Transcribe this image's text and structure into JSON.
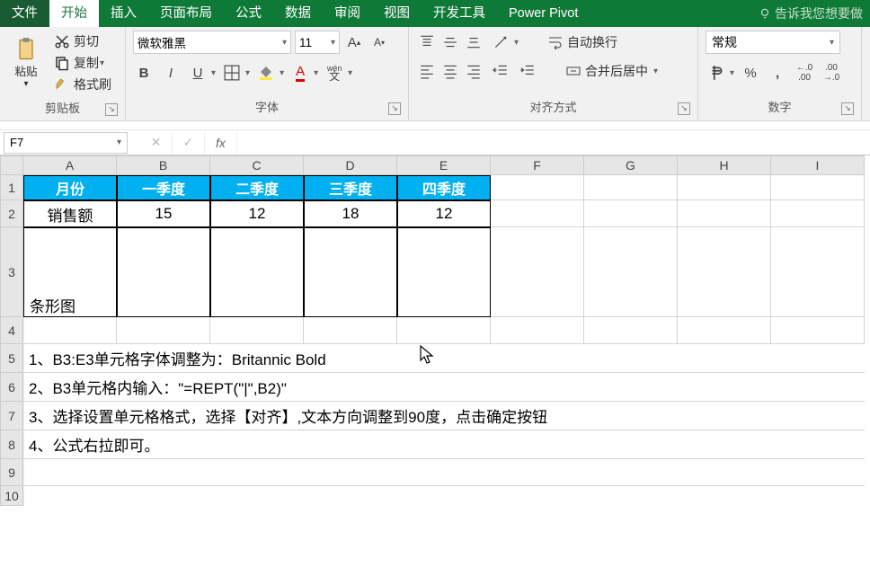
{
  "tabs": {
    "file": "文件",
    "home": "开始",
    "insert": "插入",
    "layout": "页面布局",
    "formula": "公式",
    "data": "数据",
    "review": "审阅",
    "view": "视图",
    "dev": "开发工具",
    "pivot": "Power Pivot",
    "tell": "告诉我您想要做"
  },
  "ribbon": {
    "paste": "粘贴",
    "cut": "剪切",
    "copy": "复制",
    "fmt": "格式刷",
    "clipboard_group": "剪贴板",
    "font_name": "微软雅黑",
    "font_size": "11",
    "wen": "wén",
    "wen2": "文",
    "font_group": "字体",
    "wrap": "自动换行",
    "merge": "合并后居中",
    "align_group": "对齐方式",
    "num_format": "常规",
    "num_group": "数字"
  },
  "fbar": {
    "name": "F7",
    "fx": "fx"
  },
  "chart_data": {
    "type": "table",
    "columns": [
      "月份",
      "一季度",
      "二季度",
      "三季度",
      "四季度"
    ],
    "rows": [
      {
        "label": "销售额",
        "values": [
          15,
          12,
          18,
          12
        ]
      },
      {
        "label": "条形图",
        "values": [
          "",
          "",
          "",
          ""
        ]
      }
    ]
  },
  "grid": {
    "cols": [
      "A",
      "B",
      "C",
      "D",
      "E",
      "F",
      "G",
      "H",
      "I"
    ],
    "h": {
      "a1": "月份",
      "b1": "一季度",
      "c1": "二季度",
      "d1": "三季度",
      "e1": "四季度"
    },
    "d": {
      "a2": "销售额",
      "b2": "15",
      "c2": "12",
      "d2": "18",
      "e2": "12",
      "a3": "条形图"
    },
    "notes": {
      "r5": "1、B3:E3单元格字体调整为：Britannic Bold",
      "r6": "2、B3单元格内输入：\"=REPT(\"|\",B2)\"",
      "r7": "3、选择设置单元格格式，选择【对齐】,文本方向调整到90度，点击确定按钮",
      "r8": "4、公式右拉即可。"
    }
  }
}
